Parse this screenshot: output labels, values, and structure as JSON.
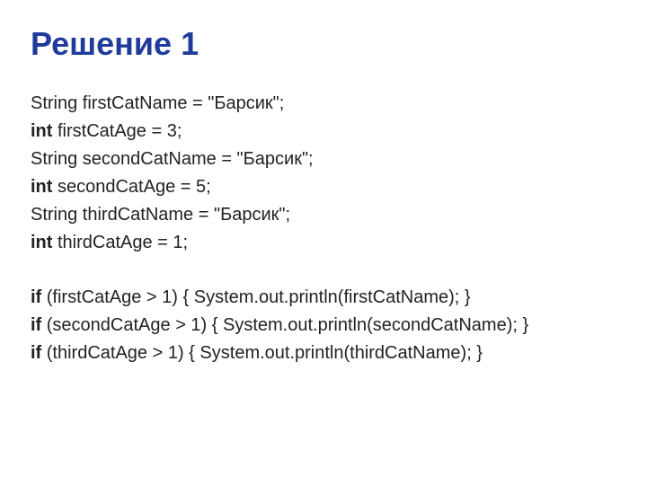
{
  "title": "Решение 1",
  "code": {
    "l1_a": "String firstCatName = \"Барсик\";",
    "l2_kw": "int",
    "l2_b": " firstCatAge = 3;",
    "l3_a": "String secondCatName = \"Барсик\";",
    "l4_kw": "int",
    "l4_b": " secondCatAge = 5;",
    "l5_a": "String thirdCatName = \"Барсик\";",
    "l6_kw": "int",
    "l6_b": " thirdCatAge = 1;",
    "l7_kw": "if",
    "l7_b": " (firstCatAge > 1) { System.out.println(firstCatName); }",
    "l8_kw": "if",
    "l8_b": " (secondCatAge > 1) { System.out.println(secondCatName); }",
    "l9_kw": "if",
    "l9_b": " (thirdCatAge > 1) { System.out.println(thirdCatName); }"
  }
}
